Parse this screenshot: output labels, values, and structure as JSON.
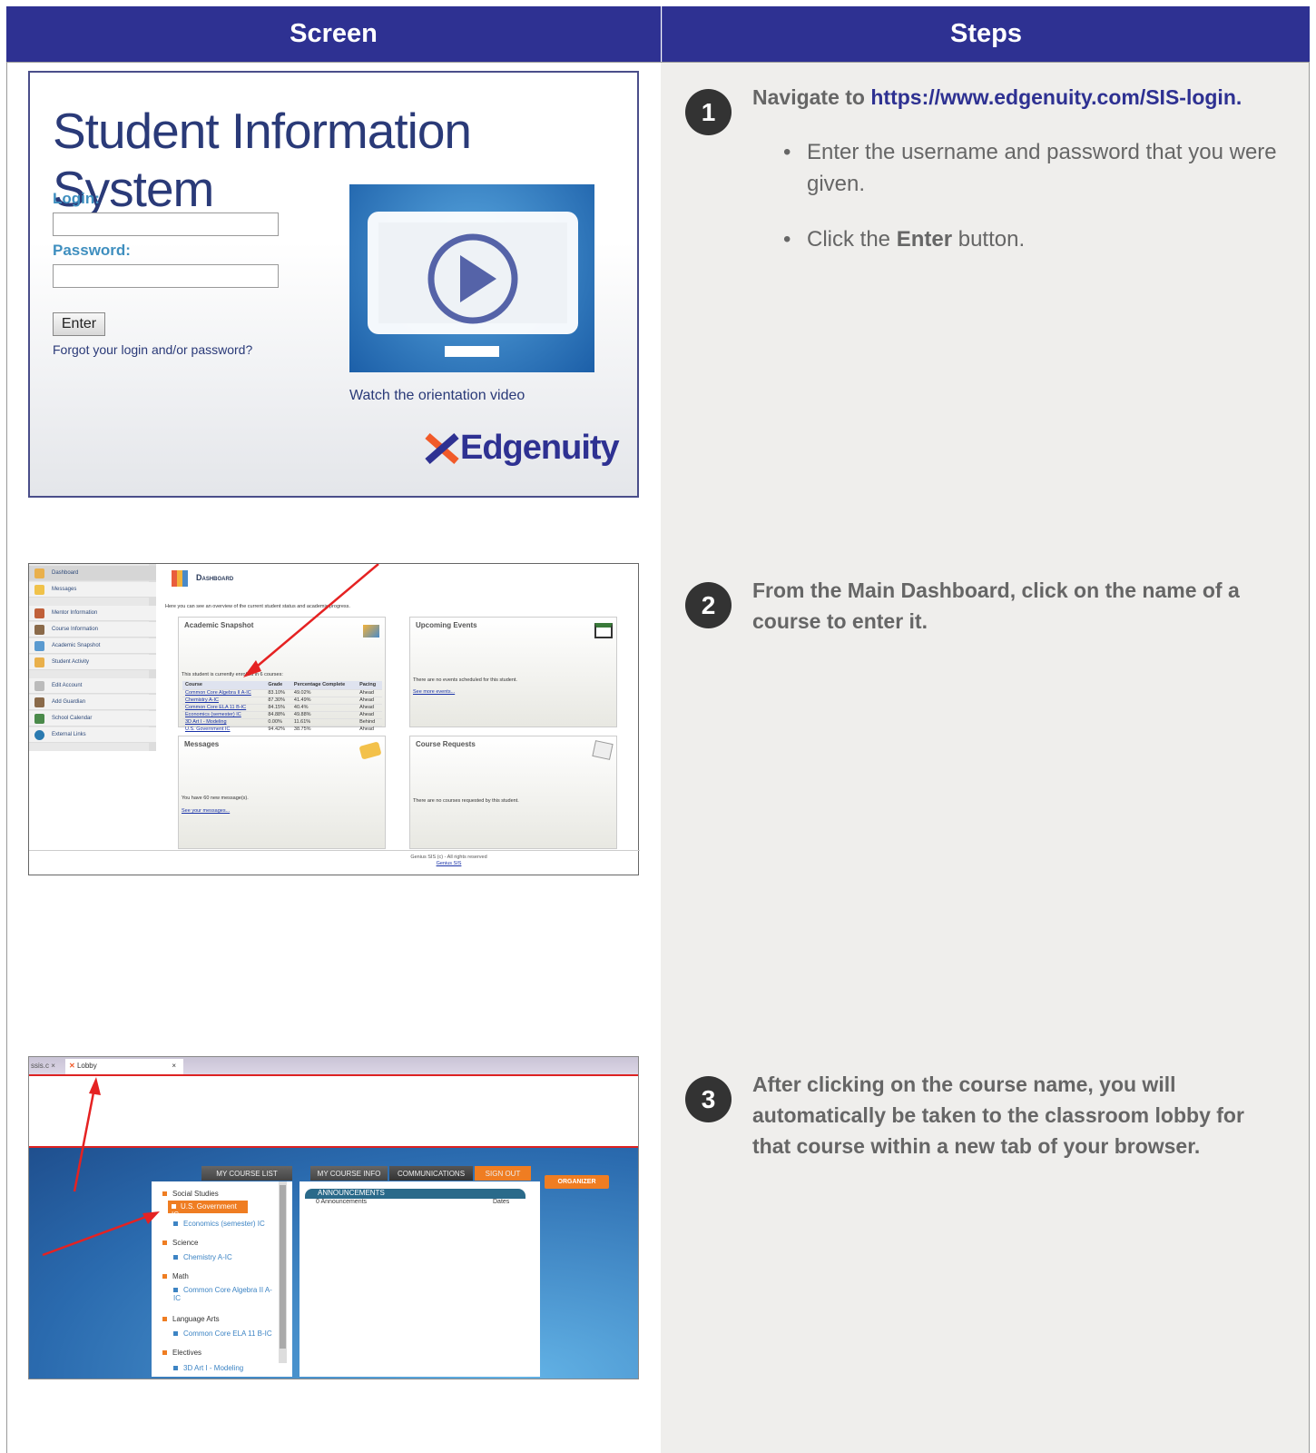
{
  "header": {
    "screen": "Screen",
    "steps": "Steps"
  },
  "row1": {
    "login": {
      "title": "Student Information System",
      "login_label": "Login:",
      "password_label": "Password:",
      "enter_button": "Enter",
      "forgot_link": "Forgot your login and/or password?",
      "video_link": "Watch the orientation video",
      "logo_text": "Edgenuity"
    },
    "step_number": "1",
    "step_intro": "Navigate to ",
    "step_url": "https://www.edgenuity.com/SIS-login.",
    "bullets": [
      "Enter the username and password that you were given.",
      "Click the ",
      "Enter",
      " button."
    ]
  },
  "row2": {
    "dashboard": {
      "sidebar": [
        "Dashboard",
        "Messages",
        "Mentor Information",
        "Course Information",
        "Academic Snapshot",
        "Student Activity",
        "Edit Account",
        "Add Guardian",
        "School Calendar",
        "External Links"
      ],
      "title": "Dashboard",
      "intro": "Here you can see an overview of the current student status and academic progress.",
      "snapshot_title": "Academic Snapshot",
      "snapshot_intro": "This student is currently enrolled in 6 courses:",
      "table_headers": [
        "Course",
        "Grade",
        "Percentage Complete",
        "Pacing"
      ],
      "table_rows": [
        [
          "Common Core Algebra II A-IC",
          "83.10%",
          "49.02%",
          "Ahead"
        ],
        [
          "Chemistry A-IC",
          "87.30%",
          "41.49%",
          "Ahead"
        ],
        [
          "Common Core ELA 11 B-IC",
          "84.15%",
          "40.4%",
          "Ahead"
        ],
        [
          "Economics (semester) IC",
          "84.88%",
          "49.88%",
          "Ahead"
        ],
        [
          "3D Art I - Modeling",
          "0.00%",
          "11.61%",
          "Behind"
        ],
        [
          "U.S. Government IC",
          "94.42%",
          "38.75%",
          "Ahead"
        ]
      ],
      "events_title": "Upcoming Events",
      "events_text": "There are no events scheduled for this student.",
      "events_link": "See more events...",
      "messages_title": "Messages",
      "messages_text": "You have 60 new message(s).",
      "messages_link": "See your messages...",
      "requests_title": "Course Requests",
      "requests_text": "There are no courses requested by this student.",
      "footer": "Genius SIS (c) - All rights reserved",
      "footer_link": "Genius SIS"
    },
    "step_number": "2",
    "step_text": "From the Main Dashboard, click on the name of a course to enter it."
  },
  "row3": {
    "lobby": {
      "tab1": "ssis.c ×",
      "tab2": "Lobby",
      "tab_close": "×",
      "menu": [
        "MY COURSE LIST",
        "MY COURSE INFO",
        "COMMUNICATIONS",
        "SIGN OUT"
      ],
      "organizer": "ORGANIZER",
      "categories": [
        {
          "name": "Social Studies",
          "courses": [
            "U.S. Government IC",
            "Economics (semester) IC"
          ]
        },
        {
          "name": "Science",
          "courses": [
            "Chemistry A-IC"
          ]
        },
        {
          "name": "Math",
          "courses": [
            "Common Core Algebra II A-IC"
          ]
        },
        {
          "name": "Language Arts",
          "courses": [
            "Common Core ELA 11 B-IC"
          ]
        },
        {
          "name": "Electives",
          "courses": [
            "3D Art I - Modeling"
          ]
        }
      ],
      "announcements_title": "ANNOUNCEMENTS",
      "announcements_count": "0 Announcements",
      "announcements_dates": "Dates"
    },
    "step_number": "3",
    "step_text": "After clicking on the course name, you will automatically be taken to the classroom lobby for that course within a new tab of your browser."
  },
  "colors": {
    "header_bg": "#2e3192",
    "steps_bg": "#efeeec",
    "accent_orange": "#ef7d22",
    "arrow_red": "#e52222"
  }
}
